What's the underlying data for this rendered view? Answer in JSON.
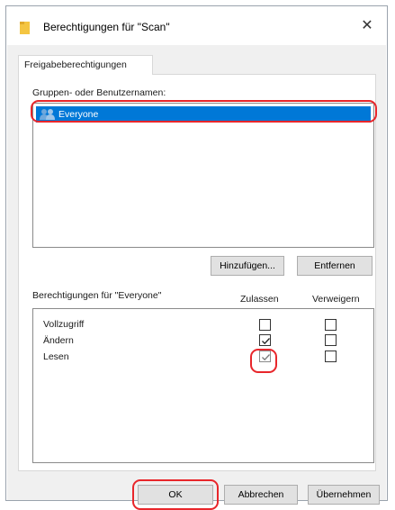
{
  "window": {
    "title": "Berechtigungen für \"Scan\"",
    "close_glyph": "✕"
  },
  "tab": {
    "label": "Freigabeberechtigungen"
  },
  "groups": {
    "label": "Gruppen- oder Benutzernamen:",
    "items": [
      {
        "name": "Everyone",
        "icon": "users-icon",
        "selected": true
      }
    ]
  },
  "buttons": {
    "add": "Hinzufügen...",
    "remove": "Entfernen",
    "ok": "OK",
    "cancel": "Abbrechen",
    "apply": "Übernehmen"
  },
  "permissions": {
    "label": "Berechtigungen für \"Everyone\"",
    "allow_header": "Zulassen",
    "deny_header": "Verweigern",
    "rows": [
      {
        "name": "Vollzugriff",
        "allow": false,
        "deny": false
      },
      {
        "name": "Ändern",
        "allow": true,
        "deny": false
      },
      {
        "name": "Lesen",
        "allow": true,
        "allow_disabled": true,
        "deny": false
      }
    ]
  },
  "colors": {
    "selection": "#0078d7",
    "highlight_ring": "#e8262b",
    "folder_icon": "#f4c542"
  }
}
